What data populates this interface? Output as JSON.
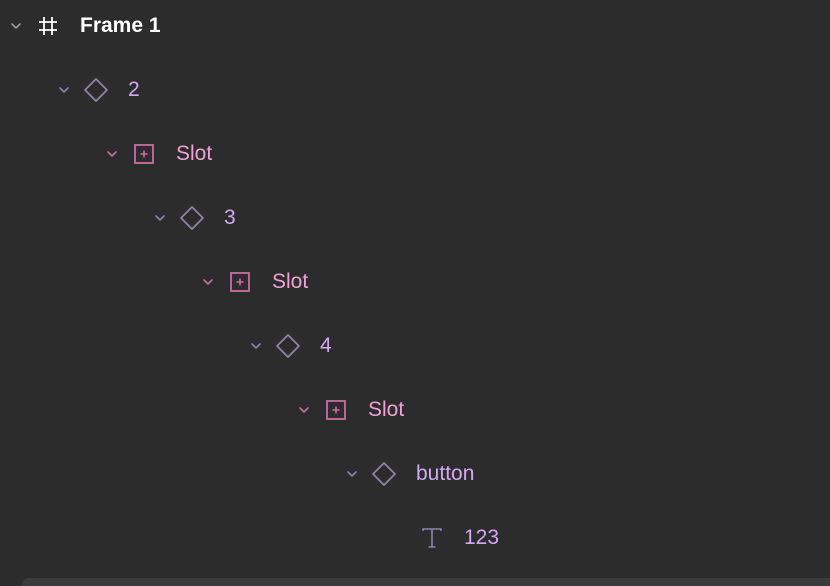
{
  "layers": [
    {
      "name": "Frame 1",
      "type": "frame",
      "icon": "frame-icon",
      "expanded": true
    },
    {
      "name": "2",
      "type": "component",
      "icon": "component-instance-icon",
      "expanded": true
    },
    {
      "name": "Slot",
      "type": "slot",
      "icon": "slot-icon",
      "expanded": true
    },
    {
      "name": "3",
      "type": "component",
      "icon": "component-instance-icon",
      "expanded": true
    },
    {
      "name": "Slot",
      "type": "slot",
      "icon": "slot-icon",
      "expanded": true
    },
    {
      "name": "4",
      "type": "component",
      "icon": "component-instance-icon",
      "expanded": true
    },
    {
      "name": "Slot",
      "type": "slot",
      "icon": "slot-icon",
      "expanded": true
    },
    {
      "name": "button",
      "type": "component",
      "icon": "component-instance-icon",
      "expanded": true
    },
    {
      "name": "123",
      "type": "text",
      "icon": "text-icon"
    }
  ],
  "colors": {
    "background": "#2c2c2c",
    "frame_label": "#ffffff",
    "component_label": "#d3a8f5",
    "component_icon": "#8f82b0",
    "slot_label": "#f0a0d8",
    "slot_icon": "#d06aa8",
    "chevron_default": "#9a9a9a",
    "chevron_component": "#8f82b0",
    "chevron_slot": "#d06aa8"
  }
}
